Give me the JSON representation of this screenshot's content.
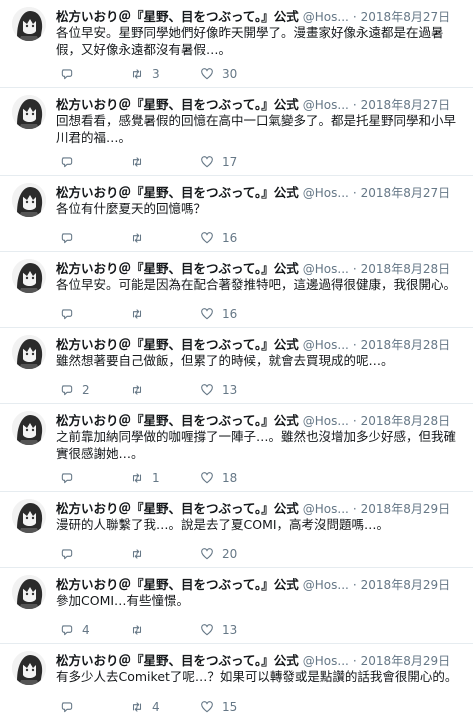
{
  "tweets": [
    {
      "name": "松方いおり＠『星野、目をつぶって。』公式",
      "handle": "@Hos...",
      "date": "2018年8月27日",
      "text": "各位早安。星野同學她們好像昨天開學了。漫畫家好像永遠都是在過暑假，又好像永遠都沒有暑假…。",
      "replies": "",
      "retweets": "3",
      "likes": "30",
      "tall": true
    },
    {
      "name": "松方いおり＠『星野、目をつぶって。』公式",
      "handle": "@Hos...",
      "date": "2018年8月27日",
      "text": "回想看看，感覺暑假的回憶在高中一口氣變多了。都是托星野同學和小早川君的福…。",
      "replies": "",
      "retweets": "",
      "likes": "17",
      "tall": true
    },
    {
      "name": "松方いおり＠『星野、目をつぶって。』公式",
      "handle": "@Hos...",
      "date": "2018年8月27日",
      "text": "各位有什麼夏天的回憶嗎？",
      "replies": "",
      "retweets": "",
      "likes": "16",
      "tall": false
    },
    {
      "name": "松方いおり＠『星野、目をつぶって。』公式",
      "handle": "@Hos...",
      "date": "2018年8月28日",
      "text": "各位早安。可能是因為在配合著發推特吧，這邊過得很健康，我很開心。",
      "replies": "",
      "retweets": "",
      "likes": "16",
      "tall": false
    },
    {
      "name": "松方いおり＠『星野、目をつぶって。』公式",
      "handle": "@Hos...",
      "date": "2018年8月28日",
      "text": "雖然想著要自己做飯，但累了的時候，就會去買現成的呢…。",
      "replies": "2",
      "retweets": "",
      "likes": "13",
      "tall": false
    },
    {
      "name": "松方いおり＠『星野、目をつぶって。』公式",
      "handle": "@Hos...",
      "date": "2018年8月28日",
      "text": "之前靠加納同學做的咖喱撐了一陣子…。雖然也沒增加多少好感，但我確實很感謝她…。",
      "replies": "",
      "retweets": "1",
      "likes": "18",
      "tall": true
    },
    {
      "name": "松方いおり＠『星野、目をつぶって。』公式",
      "handle": "@Hos...",
      "date": "2018年8月29日",
      "text": "漫研的人聯繫了我…。說是去了夏COMI，高考沒問題嗎…。",
      "replies": "",
      "retweets": "",
      "likes": "20",
      "tall": false
    },
    {
      "name": "松方いおり＠『星野、目をつぶって。』公式",
      "handle": "@Hos...",
      "date": "2018年8月29日",
      "text": "參加COMI…有些憧憬。",
      "replies": "4",
      "retweets": "",
      "likes": "13",
      "tall": false
    },
    {
      "name": "松方いおり＠『星野、目をつぶって。』公式",
      "handle": "@Hos...",
      "date": "2018年8月29日",
      "text": "有多少人去Comiket了呢…？如果可以轉發或是點讚的話我會很開心的。",
      "replies": "",
      "retweets": "4",
      "likes": "15",
      "tall": false
    }
  ]
}
